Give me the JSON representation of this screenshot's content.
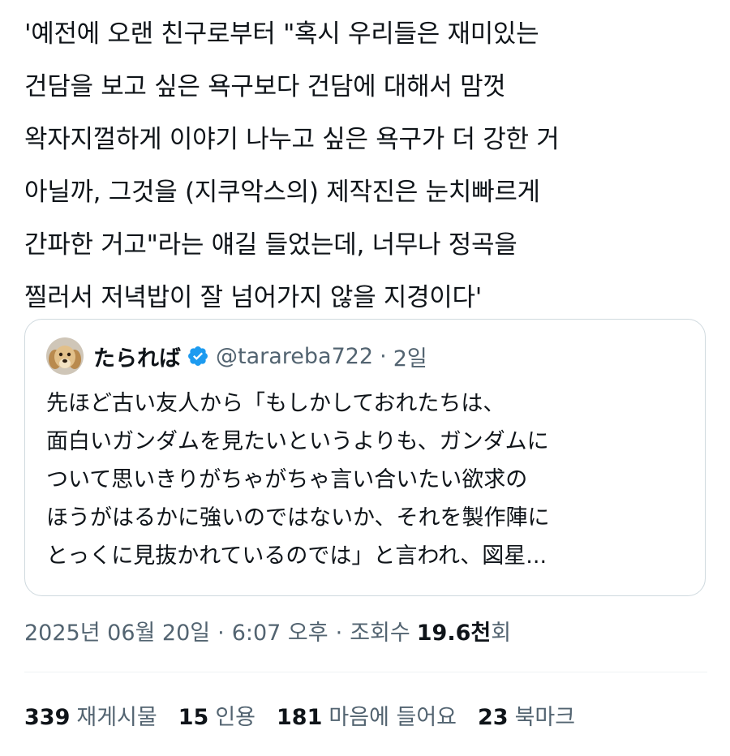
{
  "tweet": {
    "text": "'예전에 오랜 친구로부터 \"혹시 우리들은 재미있는\n건담을 보고 싶은 욕구보다 건담에 대해서 맘껏\n왁자지껄하게 이야기 나누고 싶은 욕구가 더 강한 거\n아닐까, 그것을 (지쿠악스의) 제작진은 눈치빠르게\n간파한 거고\"라는 얘길 들었는데, 너무나 정곡을\n찔러서 저녁밥이 잘 넘어가지 않을 지경이다'"
  },
  "quote": {
    "avatar_icon": "dog-avatar",
    "display_name": "たられば",
    "verified_icon": "verified-badge-icon",
    "handle": "@tarareba722",
    "separator": "·",
    "time_ago": "2일",
    "text": "先ほど古い友人から「もしかしておれたちは、\n面白いガンダムを見たいというよりも、ガンダムに\nついて思いきりがちゃがちゃ言い合いたい欲求の\nほうがはるかに強いのではないか、それを製作陣に\nとっくに見抜かれているのでは」と言われ、図星..."
  },
  "meta": {
    "date": "2025년 06월 20일",
    "separator": "·",
    "time": "6:07 오후",
    "views_label": "조회수",
    "views_count": "19.6천",
    "views_suffix": "회"
  },
  "stats": {
    "retweets": {
      "count": "339",
      "label": "재게시물"
    },
    "quotes": {
      "count": "15",
      "label": "인용"
    },
    "likes": {
      "count": "181",
      "label": "마음에 들어요"
    },
    "bookmarks": {
      "count": "23",
      "label": "북마크"
    }
  },
  "colors": {
    "primary_text": "#0f1419",
    "secondary_text": "#536471",
    "border": "#cfd9de",
    "verified_blue": "#1d9bf0"
  }
}
